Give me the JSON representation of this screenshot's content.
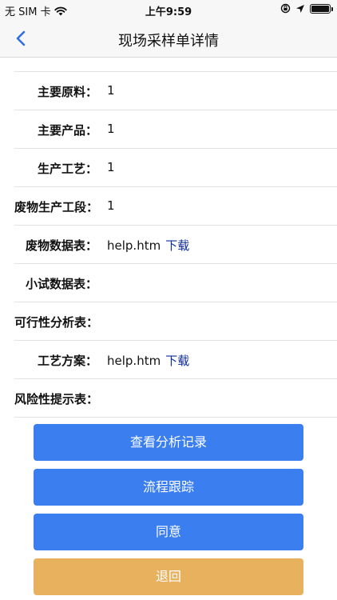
{
  "status_bar": {
    "carrier": "无 SIM 卡",
    "time": "上午9:59"
  },
  "nav": {
    "title": "现场采样单详情",
    "back_icon": "chevron-left-icon"
  },
  "fields": [
    {
      "label": "主要原料：",
      "value": "1"
    },
    {
      "label": "主要产品：",
      "value": "1"
    },
    {
      "label": "生产工艺：",
      "value": "1"
    },
    {
      "label": "废物生产工段：",
      "value": "1"
    },
    {
      "label": "废物数据表：",
      "value": "help.htm",
      "link": "下载"
    },
    {
      "label": "小试数据表：",
      "value": ""
    },
    {
      "label": "可行性分析表：",
      "value": ""
    },
    {
      "label": "工艺方案：",
      "value": "help.htm",
      "link": "下载"
    },
    {
      "label": "风险性提示表：",
      "value": ""
    }
  ],
  "buttons": {
    "view_analysis": "查看分析记录",
    "process_track": "流程跟踪",
    "agree": "同意",
    "return": "退回"
  },
  "colors": {
    "primary": "#3a7ef0",
    "warning": "#e7b15d",
    "link": "#0c2b9e"
  }
}
